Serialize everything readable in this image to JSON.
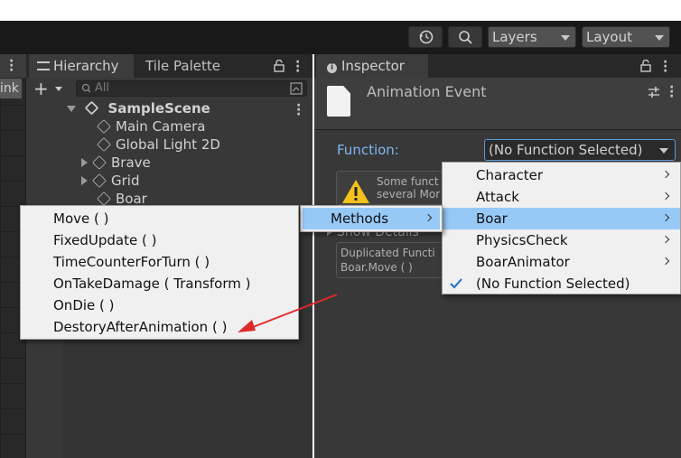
{
  "toolbar": {
    "history_icon": "history-icon",
    "search_icon": "search-icon",
    "layers_label": "Layers",
    "layout_label": "Layout"
  },
  "left_panel": {
    "tab_label": "ink"
  },
  "hierarchy": {
    "tab_label": "Hierarchy",
    "tile_palette_label": "Tile Palette",
    "add_label": "+",
    "search_placeholder": "All",
    "scene_name": "SampleScene",
    "items": [
      {
        "label": "Main Camera",
        "expandable": false
      },
      {
        "label": "Global Light 2D",
        "expandable": false
      },
      {
        "label": "Brave",
        "expandable": true
      },
      {
        "label": "Grid",
        "expandable": true
      },
      {
        "label": "Boar",
        "expandable": false
      }
    ]
  },
  "inspector": {
    "tab_label": "Inspector",
    "title": "Animation Event",
    "function_label": "Function:",
    "function_value": "(No Function Selected)",
    "warning_text_1": "Some funct",
    "warning_text_2": "several Mor",
    "show_details": "Show Details",
    "duplicated_text_1": "Duplicated Functi",
    "duplicated_text_2": "Boar.Move ( )"
  },
  "class_menu": {
    "items": [
      {
        "label": "Character",
        "submenu": true,
        "selected": false,
        "checked": false
      },
      {
        "label": "Attack",
        "submenu": true,
        "selected": false,
        "checked": false
      },
      {
        "label": "Boar",
        "submenu": true,
        "selected": true,
        "checked": false
      },
      {
        "label": "PhysicsCheck",
        "submenu": true,
        "selected": false,
        "checked": false
      },
      {
        "label": "BoarAnimator",
        "submenu": true,
        "selected": false,
        "checked": false
      },
      {
        "label": "(No Function Selected)",
        "submenu": false,
        "selected": false,
        "checked": true
      }
    ]
  },
  "methods_menu": {
    "label": "Methods"
  },
  "function_list": {
    "items": [
      "Move ( )",
      "FixedUpdate ( )",
      "TimeCounterForTurn ( )",
      "OnTakeDamage ( Transform )",
      "OnDie ( )",
      "DestoryAfterAnimation ( )"
    ]
  },
  "colors": {
    "selection": "#97c9f7",
    "annotation_arrow": "#e02a2a",
    "warning": "#f4c21a"
  }
}
